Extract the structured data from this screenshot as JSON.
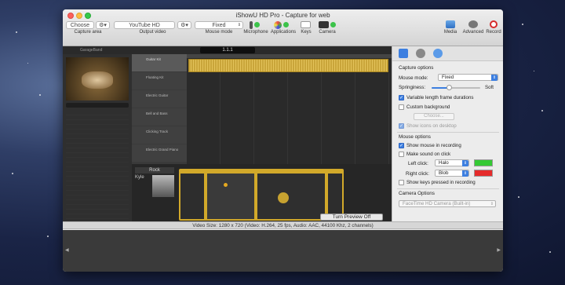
{
  "window": {
    "title": "iShowU HD Pro - Capture for web"
  },
  "toolbar": {
    "capture_area_value": "Choose",
    "capture_area_label": "Capture area",
    "output_video_value": "YouTube HD",
    "output_video_label": "Output video",
    "mouse_mode_value": "Fixed",
    "mouse_mode_label": "Mouse mode",
    "microphone_label": "Microphone",
    "applications_label": "Applications",
    "keys_label": "Keys",
    "camera_label": "Camera",
    "media_label": "Media",
    "advanced_label": "Advanced",
    "record_label": "Record"
  },
  "capture_preview": {
    "app_name": "GarageBand",
    "lcd_value": "1.1.1",
    "tracks": [
      "Guitar Kit",
      "Floating Kit",
      "Electric Guitar",
      "Bell and Bass",
      "Clicking Track",
      "Electric Grand Piano"
    ],
    "instrument_name": "Rock",
    "drummer_name": "Kyle",
    "turn_preview_off_label": "Turn Preview Off"
  },
  "panel": {
    "capture_options_heading": "Capture options",
    "mouse_mode_label": "Mouse mode:",
    "mouse_mode_value": "Fixed",
    "springiness_label": "Springiness:",
    "springiness_value": "Soft",
    "springiness_level": 0.35,
    "variable_length_label": "Variable length frame durations",
    "variable_length_checked": true,
    "custom_background_label": "Custom background",
    "custom_background_checked": false,
    "choose_button_label": "Choose...",
    "show_icons_label": "Show icons on desktop",
    "show_icons_checked": true,
    "mouse_options_heading": "Mouse options",
    "show_mouse_label": "Show mouse in recording",
    "show_mouse_checked": true,
    "make_sound_label": "Make sound on click",
    "make_sound_checked": false,
    "left_click_label": "Left click:",
    "left_click_value": "Halo",
    "left_click_color": "#34c934",
    "right_click_label": "Right click:",
    "right_click_value": "Blob",
    "right_click_color": "#e52b2b",
    "show_keys_label": "Show keys pressed in recording",
    "show_keys_checked": false,
    "camera_options_heading": "Camera Options",
    "camera_value": "FaceTime HD Camera (Built-in)"
  },
  "status": {
    "text": "Video Size: 1280 x 720    (Video: H.264, 25 fps, Audio: AAC, 44100 Khz, 2 channels)"
  },
  "colors": {
    "accent": "#3d7fe0",
    "record": "#d62b2b",
    "track_region": "#c9a53a"
  }
}
